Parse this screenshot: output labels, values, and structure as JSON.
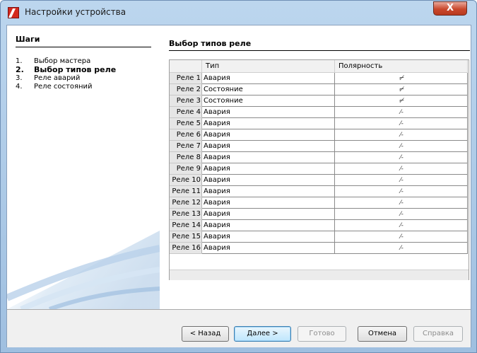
{
  "window": {
    "title": "Настройки устройства",
    "close_glyph": "X"
  },
  "sidebar": {
    "title": "Шаги",
    "steps": [
      {
        "num": "1.",
        "label": "Выбор мастера"
      },
      {
        "num": "2.",
        "label": "Выбор типов реле"
      },
      {
        "num": "3.",
        "label": "Реле аварий"
      },
      {
        "num": "4.",
        "label": "Реле состояний"
      }
    ],
    "active_step": 2
  },
  "content": {
    "title": "Выбор типов реле",
    "table": {
      "columns": [
        "Тип",
        "Полярность"
      ],
      "rows": [
        {
          "relay": "Реле 1",
          "type": "Авария",
          "polarity": "⌐̸"
        },
        {
          "relay": "Реле 2",
          "type": "Состояние",
          "polarity": "⌐̸"
        },
        {
          "relay": "Реле 3",
          "type": "Состояние",
          "polarity": "⌐̸"
        },
        {
          "relay": "Реле 4",
          "type": "Авария",
          "polarity": "⁄-"
        },
        {
          "relay": "Реле 5",
          "type": "Авария",
          "polarity": "⁄-"
        },
        {
          "relay": "Реле 6",
          "type": "Авария",
          "polarity": "⁄-"
        },
        {
          "relay": "Реле 7",
          "type": "Авария",
          "polarity": "⁄-"
        },
        {
          "relay": "Реле 8",
          "type": "Авария",
          "polarity": "⁄-"
        },
        {
          "relay": "Реле 9",
          "type": "Авария",
          "polarity": "⁄-"
        },
        {
          "relay": "Реле 10",
          "type": "Авария",
          "polarity": "⁄-"
        },
        {
          "relay": "Реле 11",
          "type": "Авария",
          "polarity": "⁄-"
        },
        {
          "relay": "Реле 12",
          "type": "Авария",
          "polarity": "⁄-"
        },
        {
          "relay": "Реле 13",
          "type": "Авария",
          "polarity": "⁄-"
        },
        {
          "relay": "Реле 14",
          "type": "Авария",
          "polarity": "⁄-"
        },
        {
          "relay": "Реле 15",
          "type": "Авария",
          "polarity": "⁄-"
        },
        {
          "relay": "Реле 16",
          "type": "Авария",
          "polarity": "⁄-"
        }
      ]
    }
  },
  "footer": {
    "back": "< Назад",
    "next": "Далее >",
    "finish": "Готово",
    "cancel": "Отмена",
    "help": "Справка"
  },
  "colors": {
    "accent": "#3c7fb1",
    "close": "#c9482c",
    "titlebar": "#bcd6ee"
  },
  "icons": {
    "app": "app-logo-icon",
    "close": "close-icon"
  }
}
